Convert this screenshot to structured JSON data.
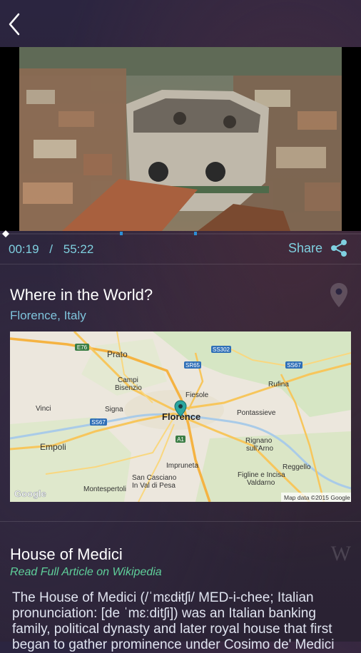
{
  "player": {
    "current_time": "00:19",
    "separator": "/",
    "total_time": "55:22",
    "share_label": "Share",
    "progress_fraction": 0.0057
  },
  "location": {
    "title": "Where in the World?",
    "place": "Florence, Italy",
    "map_labels": {
      "prato": "Prato",
      "campi": "Campi",
      "bisenzio": "Bisenzio",
      "fiesole": "Fiesole",
      "florence": "Florence",
      "signa": "Signa",
      "vinci": "Vinci",
      "empoli": "Empoli",
      "rufina": "Rufina",
      "pontassieve": "Pontassieve",
      "rignano": "Rignano",
      "sullarno": "sull'Arno",
      "impruneta": "Impruneta",
      "reggello": "Reggello",
      "sancasciano": "San Casciano",
      "invaldipesa": "In Val di Pesa",
      "montespertoli": "Montespertoli",
      "figline": "Figline e Incisa",
      "valdarno": "Valdarno",
      "e76": "E76",
      "ss302": "SS302",
      "sr65": "SR65",
      "ss67a": "SS67",
      "ss67b": "SS67",
      "a1": "A1",
      "google": "Google",
      "attribution": "Map data ©2015 Google"
    }
  },
  "article": {
    "title": "House of Medici",
    "link_label": "Read Full Article on Wikipedia",
    "logo": "W",
    "body": "The House of Medici (/ˈmɛdɨtʃi/ MED-i-chee; Italian pronunciation: [de ˈmɛːditʃi]) was an Italian banking family, political dynasty and later royal house that first began to gather prominence under Cosimo de' Medici"
  },
  "colors": {
    "accent": "#7fd0e0",
    "link_green": "#5fcf9a"
  },
  "icons": {
    "back": "chevron-left-icon",
    "share": "share-icon",
    "pin": "map-pin-icon"
  }
}
